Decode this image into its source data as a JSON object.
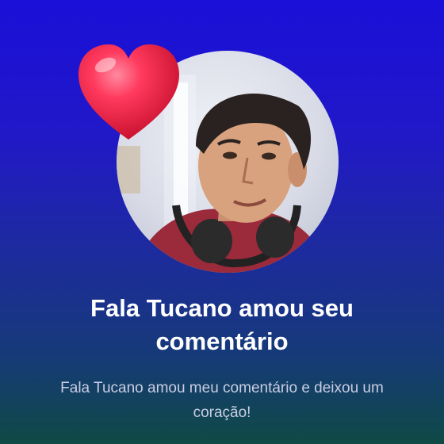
{
  "notification": {
    "title": "Fala Tucano amou seu comentário",
    "message": "Fala Tucano amou meu comentário e deixou um coração!",
    "icon": "heart-icon",
    "avatar": "user-avatar"
  },
  "colors": {
    "background_top": "#1a10d8",
    "background_bottom": "#0f4a45",
    "heart": "#f0204a",
    "title_text": "#ffffff",
    "message_text": "#c9cde4"
  }
}
